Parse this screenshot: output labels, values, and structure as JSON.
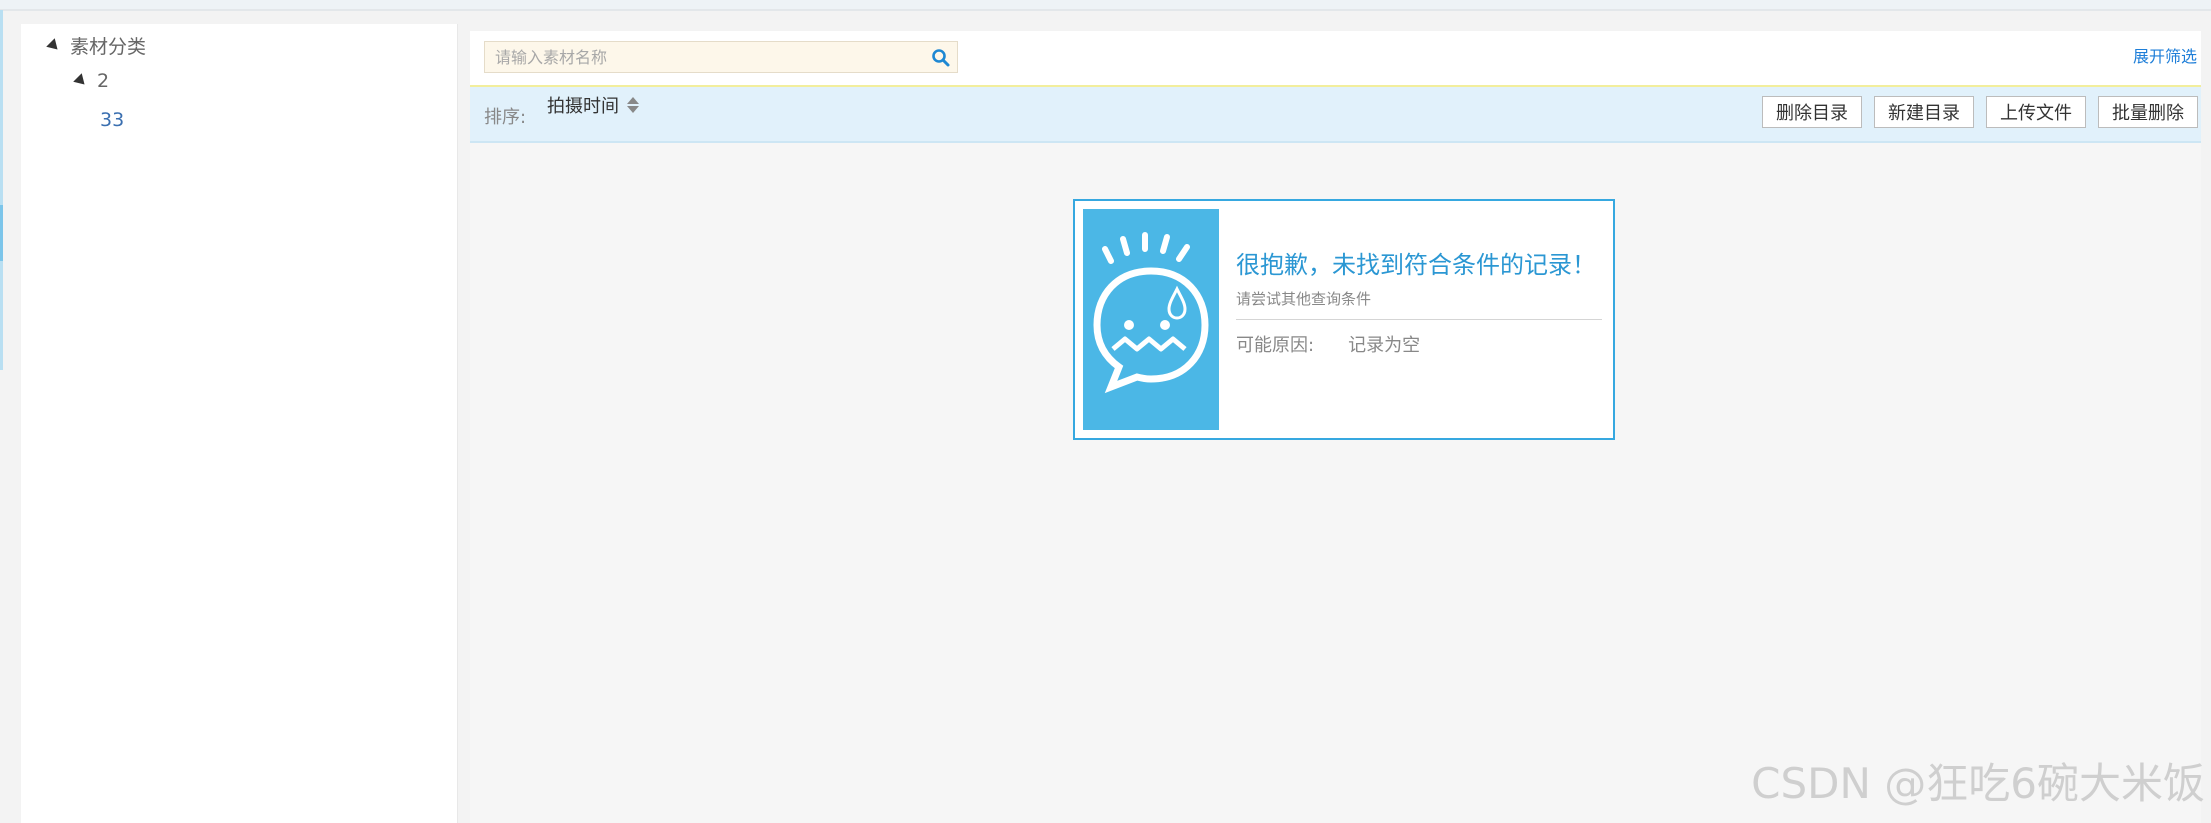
{
  "sidebar": {
    "tree": {
      "root_label": "素材分类",
      "child_label": "2",
      "grandchild_label": "33"
    }
  },
  "search": {
    "placeholder": "请输入素材名称",
    "expand_filter_label": "展开筛选"
  },
  "toolbar": {
    "sort_label": "排序:",
    "sort_field": "拍摄时间",
    "buttons": [
      "删除目录",
      "新建目录",
      "上传文件",
      "批量删除"
    ]
  },
  "empty_state": {
    "title": "很抱歉，未找到符合条件的记录！",
    "subtitle": "请尝试其他查询条件",
    "reason_label": "可能原因:",
    "reason_value": "记录为空"
  },
  "watermark": "CSDN @狂吃6碗大米饭",
  "colors": {
    "accent": "#2b97d3",
    "toolbar_bg": "#e1f1fb",
    "icon_bg": "#4bb7e6"
  },
  "icons": [
    "search-icon",
    "expand-triangle-icon",
    "sort-icon",
    "sad-face-icon"
  ]
}
